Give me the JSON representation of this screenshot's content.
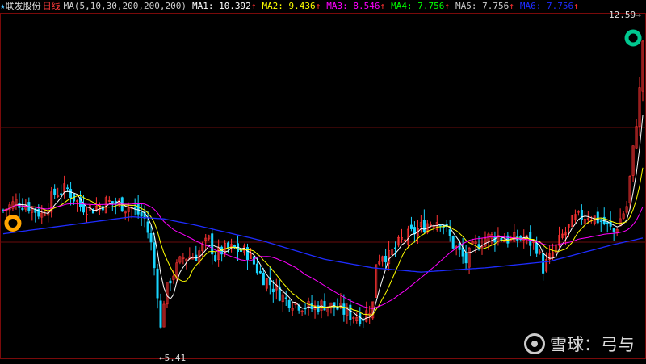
{
  "header": {
    "star": "★",
    "stock_name": "联发股份",
    "period": "日线",
    "ma_params": "MA(5,10,30,200,200,200)",
    "ma_values": [
      {
        "label": "MA1: 10.392",
        "color": "#ffffff",
        "arrow": "↑"
      },
      {
        "label": "MA2: 9.436",
        "color": "#ffff00",
        "arrow": "↑"
      },
      {
        "label": "MA3: 8.546",
        "color": "#ff00ff",
        "arrow": "↑"
      },
      {
        "label": "MA4: 7.756",
        "color": "#00ff00",
        "arrow": "↑"
      },
      {
        "label": "MA5: 7.756",
        "color": "#cfcfcf",
        "arrow": "↑"
      },
      {
        "label": "MA6: 7.756",
        "color": "#1e2cff",
        "arrow": "↑"
      }
    ]
  },
  "watermark": {
    "text": "雪球：弓与"
  },
  "chart_data": {
    "type": "candlestick",
    "ylim": [
      5.0,
      13.0
    ],
    "high_label": "12.59",
    "low_label": "5.41",
    "colors": {
      "up": "#ff3333",
      "down": "#19d5ff",
      "ma5": "#ffffff",
      "ma10": "#ffff00",
      "ma30": "#ff00ff",
      "ma200": "#1e2cff"
    },
    "markers": [
      {
        "name": "start-marker",
        "price": 8.1,
        "index": 3,
        "color": "#ffa500"
      },
      {
        "name": "end-marker",
        "price": 12.45,
        "index": 196,
        "color": "#00c890"
      }
    ],
    "price_path": [
      [
        0,
        8.4
      ],
      [
        4,
        8.6
      ],
      [
        8,
        8.5
      ],
      [
        12,
        8.3
      ],
      [
        16,
        8.8
      ],
      [
        20,
        8.9
      ],
      [
        24,
        8.5
      ],
      [
        28,
        8.45
      ],
      [
        32,
        8.6
      ],
      [
        36,
        8.55
      ],
      [
        40,
        8.45
      ],
      [
        44,
        8.2
      ],
      [
        46,
        7.6
      ],
      [
        48,
        6.5
      ],
      [
        49,
        5.6
      ],
      [
        50,
        6.3
      ],
      [
        52,
        6.8
      ],
      [
        56,
        7.3
      ],
      [
        60,
        7.35
      ],
      [
        64,
        7.7
      ],
      [
        66,
        7.3
      ],
      [
        68,
        7.45
      ],
      [
        72,
        7.5
      ],
      [
        76,
        7.4
      ],
      [
        80,
        6.9
      ],
      [
        84,
        6.6
      ],
      [
        88,
        6.3
      ],
      [
        92,
        6.2
      ],
      [
        96,
        6.1
      ],
      [
        100,
        6.2
      ],
      [
        104,
        6.1
      ],
      [
        108,
        5.95
      ],
      [
        112,
        5.9
      ],
      [
        115,
        6.2
      ],
      [
        116,
        7.2
      ],
      [
        118,
        7.4
      ],
      [
        120,
        7.3
      ],
      [
        124,
        7.7
      ],
      [
        128,
        7.9
      ],
      [
        132,
        8.1
      ],
      [
        136,
        8.2
      ],
      [
        140,
        7.6
      ],
      [
        144,
        7.2
      ],
      [
        146,
        7.5
      ],
      [
        150,
        7.75
      ],
      [
        154,
        7.8
      ],
      [
        158,
        7.7
      ],
      [
        162,
        7.75
      ],
      [
        166,
        7.55
      ],
      [
        168,
        7.05
      ],
      [
        170,
        7.25
      ],
      [
        174,
        7.8
      ],
      [
        178,
        8.2
      ],
      [
        182,
        8.3
      ],
      [
        186,
        8.15
      ],
      [
        190,
        7.9
      ],
      [
        192,
        8.2
      ],
      [
        194,
        8.5
      ],
      [
        196,
        9.8
      ],
      [
        198,
        11.2
      ],
      [
        199,
        12.4
      ]
    ],
    "ma200_path": [
      [
        0,
        7.85
      ],
      [
        20,
        8.05
      ],
      [
        40,
        8.25
      ],
      [
        50,
        8.2
      ],
      [
        60,
        8.05
      ],
      [
        80,
        7.7
      ],
      [
        100,
        7.25
      ],
      [
        115,
        7.05
      ],
      [
        130,
        6.95
      ],
      [
        150,
        7.05
      ],
      [
        170,
        7.2
      ],
      [
        190,
        7.6
      ],
      [
        199,
        7.75
      ]
    ]
  }
}
